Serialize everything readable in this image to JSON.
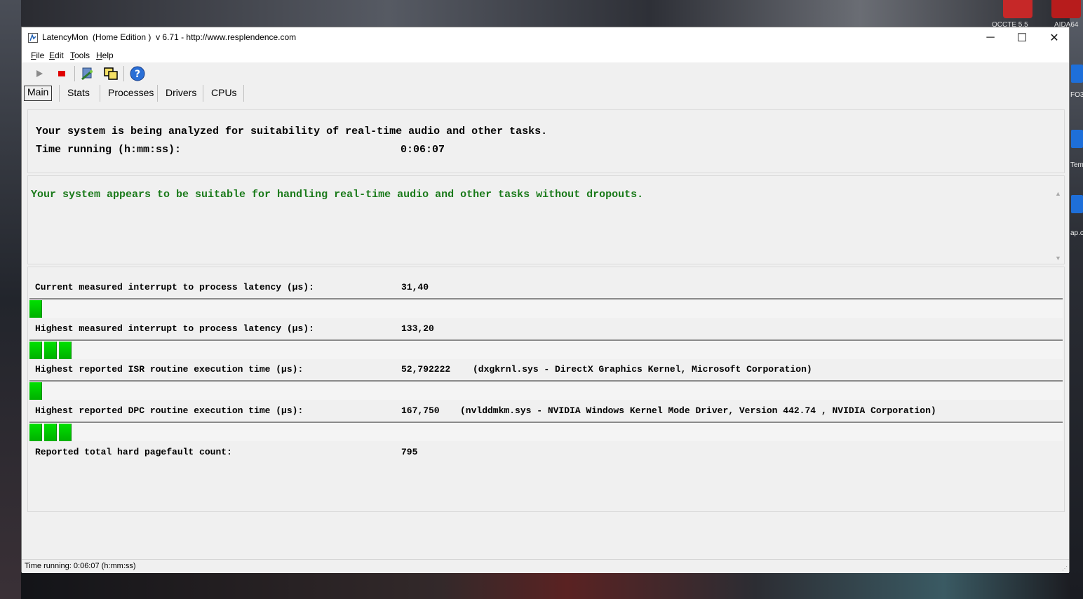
{
  "desktop": {
    "icons": [
      {
        "label": "OCCTE 5.5"
      },
      {
        "label": "AIDA64"
      }
    ],
    "side_labels": [
      "FO3",
      "Tem",
      "ap.c"
    ]
  },
  "window": {
    "title": "LatencyMon  (Home Edition )  v 6.71 - http://www.resplendence.com",
    "controls": {
      "minimize": "─",
      "maximize": "☐",
      "close": "✕"
    }
  },
  "menu": [
    "File",
    "Edit",
    "Tools",
    "Help"
  ],
  "toolbar": {
    "buttons": [
      {
        "name": "start-monitor-button",
        "icon": "play-icon"
      },
      {
        "name": "stop-monitor-button",
        "icon": "stop-icon"
      },
      {
        "name": "report-button",
        "icon": "wand-icon"
      },
      {
        "name": "copy-button",
        "icon": "copy-windows-icon"
      },
      {
        "name": "help-button",
        "icon": "help-icon"
      }
    ]
  },
  "tabs": [
    "Main",
    "Stats",
    "Processes",
    "Drivers",
    "CPUs"
  ],
  "active_tab": "Main",
  "main": {
    "header_line": "Your system is being analyzed for suitability of real-time audio and other tasks.",
    "time_label": "Time running (h:mm:ss):",
    "time_value": "0:06:07",
    "verdict": "Your system appears to be suitable for handling real-time audio and other tasks without dropouts.",
    "verdict_color": "#1a7a1a",
    "metrics": [
      {
        "label": "Current measured interrupt to process latency (µs):",
        "value": "31,40",
        "detail": "",
        "bar_segments": 1
      },
      {
        "label": "Highest measured interrupt to process latency (µs):",
        "value": "133,20",
        "detail": "",
        "bar_segments": 3
      },
      {
        "label": "Highest reported ISR routine execution time (µs):",
        "value": "52,792222",
        "detail": "(dxgkrnl.sys - DirectX Graphics Kernel, Microsoft Corporation)",
        "bar_segments": 1
      },
      {
        "label": "Highest reported DPC routine execution time (µs):",
        "value": "167,750",
        "detail": "(nvlddmkm.sys - NVIDIA Windows Kernel Mode Driver, Version 442.74 , NVIDIA Corporation)",
        "bar_segments": 3
      },
      {
        "label": "Reported total hard pagefault count:",
        "value": "795",
        "detail": "",
        "bar_segments": null
      }
    ],
    "bar_color": "#00c800"
  },
  "status_bar": "Time running: 0:06:07  (h:mm:ss)"
}
